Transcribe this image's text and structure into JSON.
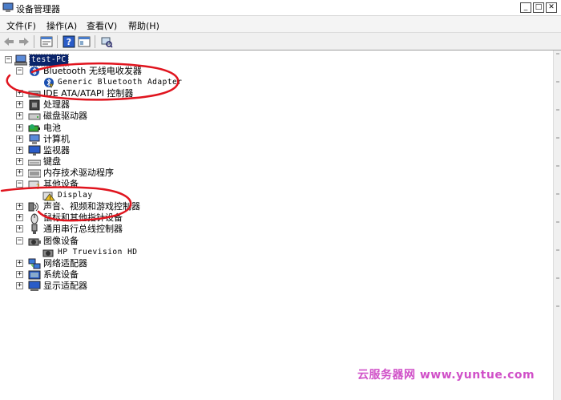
{
  "window": {
    "title": "设备管理器",
    "minimize": "_",
    "maximize": "□",
    "close": "✕"
  },
  "menu": [
    {
      "label": "文件(F)"
    },
    {
      "label": "操作(A)"
    },
    {
      "label": "查看(V)"
    },
    {
      "label": "帮助(H)"
    }
  ],
  "toolbar": [
    "back-icon",
    "forward-icon",
    "properties-icon",
    "help-icon",
    "view-icon",
    "scan-hardware-icon"
  ],
  "tree": {
    "root": "test-PC",
    "nodes": [
      {
        "label": "Bluetooth 无线电收发器",
        "expander": "−"
      },
      {
        "label": "Generic Bluetooth Adapter"
      },
      {
        "label": "IDE ATA/ATAPI 控制器",
        "expander": "+"
      },
      {
        "label": "处理器",
        "expander": "+"
      },
      {
        "label": "磁盘驱动器",
        "expander": "+"
      },
      {
        "label": "电池",
        "expander": "+"
      },
      {
        "label": "计算机",
        "expander": "+"
      },
      {
        "label": "监视器",
        "expander": "+"
      },
      {
        "label": "键盘",
        "expander": "+"
      },
      {
        "label": "内存技术驱动程序",
        "expander": "+"
      },
      {
        "label": "其他设备",
        "expander": "−"
      },
      {
        "label": "Display"
      },
      {
        "label": "声音、视频和游戏控制器",
        "expander": "+"
      },
      {
        "label": "鼠标和其他指针设备",
        "expander": "+"
      },
      {
        "label": "通用串行总线控制器",
        "expander": "+"
      },
      {
        "label": "图像设备",
        "expander": "−"
      },
      {
        "label": "HP Truevision HD"
      },
      {
        "label": "网络适配器",
        "expander": "+"
      },
      {
        "label": "系统设备",
        "expander": "+"
      },
      {
        "label": "显示适配器",
        "expander": "+"
      }
    ],
    "root_expander": "−"
  },
  "watermark": "云服务器网 www.yuntue.com",
  "colors": {
    "selection": "#0a246a",
    "annotation": "#e0141e",
    "watermark": "#d050c8"
  }
}
